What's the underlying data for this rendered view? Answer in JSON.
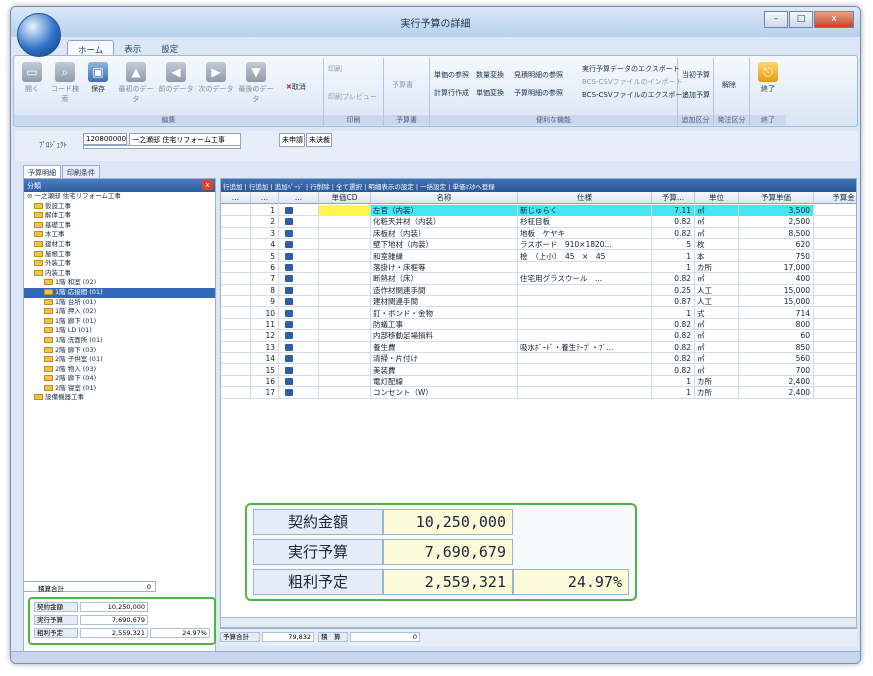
{
  "window": {
    "title": "実行予算の詳細",
    "buttons": [
      "–",
      "□",
      "x"
    ]
  },
  "menu_tabs": [
    "ホーム",
    "表示",
    "設定"
  ],
  "ribbon": {
    "buttons": [
      "開く",
      "コード検索",
      "保存",
      "最初のデータ",
      "前のデータ",
      "次のデータ",
      "最後のデータ",
      "取消"
    ],
    "groups": [
      "編集",
      "印刷",
      "予算書",
      "便利な機能",
      "追加区分",
      "発注区分",
      "終了"
    ],
    "print": [
      "印刷",
      "印刷プレビュー"
    ],
    "budget": [
      "予算書"
    ],
    "tools": [
      "単価の参照",
      "数量変換",
      "見積明細の参照",
      "計算行作成",
      "単価変換",
      "予算明細の参照",
      "実行予算データのエクスポート",
      "BCS-CSVファイルのインポート",
      "BCS-CSVファイルのエクスポート"
    ],
    "add": [
      "当初予算",
      "追加予算"
    ],
    "cancel": "解除",
    "exit": "終了"
  },
  "project": {
    "label": "ﾌﾟﾛｼﾞｪｸﾄ",
    "code": "1208000002",
    "name": "一之瀬邸 住宅リフォーム工事",
    "status1": "未申請",
    "status2": "未決裁"
  },
  "subtabs": [
    "予算明細",
    "印刷条件"
  ],
  "tree": {
    "header": "分類",
    "root": "一之瀬邸 住宅リフォーム工事",
    "items": [
      {
        "label": "仮設工事",
        "level": 1
      },
      {
        "label": "解体工事",
        "level": 1
      },
      {
        "label": "基礎工事",
        "level": 1
      },
      {
        "label": "木工事",
        "level": 1
      },
      {
        "label": "建材工事",
        "level": 1
      },
      {
        "label": "屋根工事",
        "level": 1
      },
      {
        "label": "外装工事",
        "level": 1
      },
      {
        "label": "内装工事",
        "level": 1
      },
      {
        "label": "1階 和室 (02)",
        "level": 2
      },
      {
        "label": "1階 応接間 (01)",
        "level": 2,
        "selected": true
      },
      {
        "label": "1階 台所 (01)",
        "level": 2
      },
      {
        "label": "1階 押入 (02)",
        "level": 2
      },
      {
        "label": "1階 廊下 (01)",
        "level": 2
      },
      {
        "label": "1階 LD (01)",
        "level": 2
      },
      {
        "label": "1階 洗面所 (01)",
        "level": 2
      },
      {
        "label": "2階 廊下 (03)",
        "level": 2
      },
      {
        "label": "2階 子供室 (01)",
        "level": 2
      },
      {
        "label": "2階 物入 (03)",
        "level": 2
      },
      {
        "label": "2階 廊下 (04)",
        "level": 2
      },
      {
        "label": "2階 寝室 (01)",
        "level": 2
      },
      {
        "label": "設備機器工事",
        "level": 1
      }
    ]
  },
  "left_summary": {
    "total_label": "積算合計",
    "total_value": "0",
    "contract_label": "契約金額",
    "contract_value": "10,250,000",
    "budget_label": "実行予算",
    "budget_value": "7,690,679",
    "profit_label": "粗利予定",
    "profit_value": "2,559,321",
    "profit_rate": "24.97%"
  },
  "grid": {
    "toolbar": "行追加 | 行追加 | 追加ﾍﾟｰｼﾞ | 行削除 | 全て選択 | 明細表示の設定 | 一括設定 | 単価ﾏｽﾀへ登録",
    "headers": [
      "...",
      "...",
      "...",
      "単価CD",
      "名称",
      "仕様",
      "予算...",
      "単位",
      "予算単価",
      "予算金"
    ],
    "rows": [
      {
        "no": "1",
        "name": "左官（内装）",
        "spec": "新じゅらく",
        "qty": "7.11",
        "unit": "㎡",
        "price": "3,500",
        "hl": true
      },
      {
        "no": "2",
        "name": "化粧天井材（内装）",
        "spec": "杉柾目板",
        "qty": "0.82",
        "unit": "㎡",
        "price": "2,500"
      },
      {
        "no": "3",
        "name": "床板材（内装）",
        "spec": "地板　ケヤキ",
        "qty": "0.82",
        "unit": "㎡",
        "price": "8,500"
      },
      {
        "no": "4",
        "name": "壁下地材（内装）",
        "spec": "ラスボード　910×1820...",
        "qty": "5",
        "unit": "枚",
        "price": "620"
      },
      {
        "no": "5",
        "name": "和室雑縁",
        "spec": "桧　（上小）　45　×　45",
        "qty": "1",
        "unit": "本",
        "price": "750"
      },
      {
        "no": "6",
        "name": "落掛け・床框等",
        "spec": "",
        "qty": "1",
        "unit": "カ所",
        "price": "17,000"
      },
      {
        "no": "7",
        "name": "断熱材（床）",
        "spec": "住宅用グラスウール　...",
        "qty": "0.82",
        "unit": "㎡",
        "price": "400"
      },
      {
        "no": "8",
        "name": "造作材関連手間",
        "spec": "",
        "qty": "0.25",
        "unit": "人工",
        "price": "15,000"
      },
      {
        "no": "9",
        "name": "建材関連手間",
        "spec": "",
        "qty": "0.87",
        "unit": "人工",
        "price": "15,000"
      },
      {
        "no": "10",
        "name": "釘・ボンド・金物",
        "spec": "",
        "qty": "1",
        "unit": "式",
        "price": "714"
      },
      {
        "no": "11",
        "name": "防蟻工事",
        "spec": "",
        "qty": "0.82",
        "unit": "㎡",
        "price": "800"
      },
      {
        "no": "12",
        "name": "内部移動足場損料",
        "spec": "",
        "qty": "0.82",
        "unit": "㎡",
        "price": "60"
      },
      {
        "no": "13",
        "name": "養生費",
        "spec": "吸水ﾎﾞｰﾄﾞ・養生ﾃｰﾌﾟ・ﾌﾞ...",
        "qty": "0.82",
        "unit": "㎡",
        "price": "850"
      },
      {
        "no": "14",
        "name": "清掃・片付け",
        "spec": "",
        "qty": "0.82",
        "unit": "㎡",
        "price": "560"
      },
      {
        "no": "15",
        "name": "美装費",
        "spec": "",
        "qty": "0.82",
        "unit": "㎡",
        "price": "700"
      },
      {
        "no": "16",
        "name": "電灯配線",
        "spec": "",
        "qty": "1",
        "unit": "カ所",
        "price": "2,400"
      },
      {
        "no": "17",
        "name": "コンセント（W）",
        "spec": "",
        "qty": "1",
        "unit": "カ所",
        "price": "2,400"
      }
    ],
    "footer": {
      "total_label": "予算合計",
      "total_value": "79,832",
      "tsumi_label": "積　算",
      "tsumi_value": "0"
    }
  },
  "overlay": {
    "contract_label": "契約金額",
    "contract_value": "10,250,000",
    "budget_label": "実行予算",
    "budget_value": "7,690,679",
    "profit_label": "粗利予定",
    "profit_value": "2,559,321",
    "profit_rate": "24.97%"
  },
  "colors": {
    "accent": "#2f5c9e",
    "highlight_row": "#44e6f2",
    "overlay_border": "#4db544"
  }
}
